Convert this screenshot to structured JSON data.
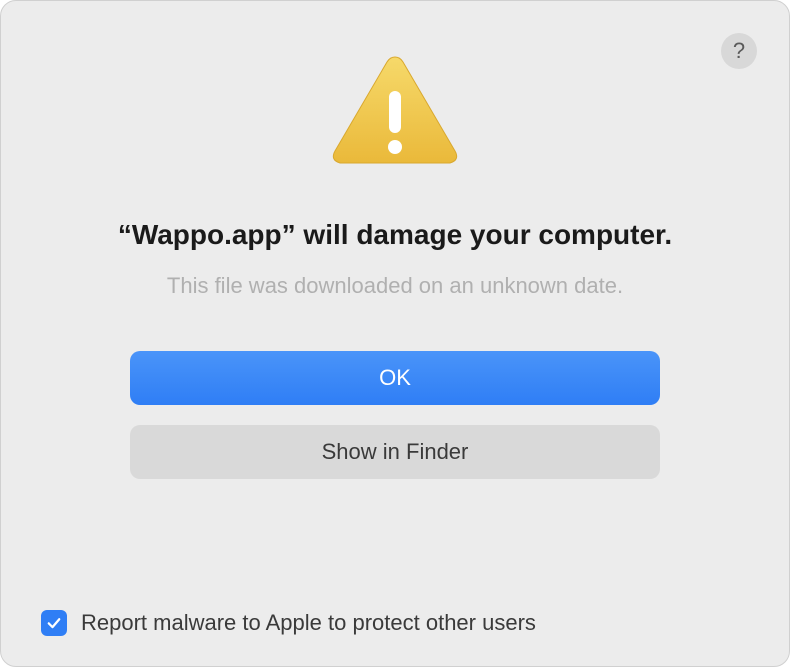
{
  "dialog": {
    "title": "“Wappo.app” will damage your computer.",
    "subtitle": "This file was downloaded on an unknown date.",
    "help_label": "?",
    "buttons": {
      "primary": "OK",
      "secondary": "Show in Finder"
    },
    "checkbox": {
      "checked": true,
      "label": "Report malware to Apple to protect other users"
    }
  }
}
